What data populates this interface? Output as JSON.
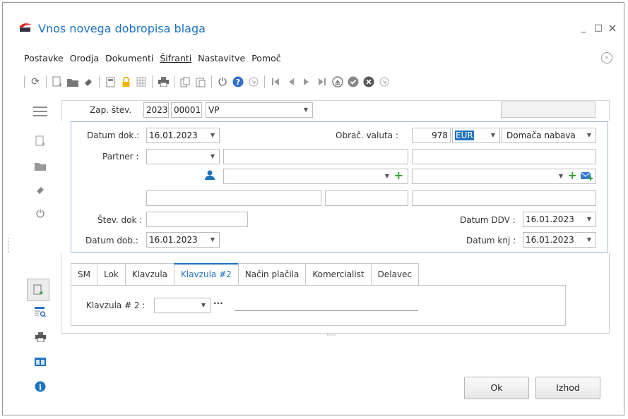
{
  "window": {
    "title": "Vnos novega dobropisa blaga",
    "minimize": "_",
    "maximize": "□",
    "close": "×"
  },
  "menu": [
    "Postavke",
    "Orodja",
    "Dokumenti",
    "Šifranti",
    "Nastavitve",
    "Pomoč"
  ],
  "header": {
    "zap_label": "Zap. štev.",
    "year": "2023",
    "number": "00001",
    "type": "VP"
  },
  "form": {
    "datum_dok_label": "Datum dok.:",
    "datum_dok": "16.01.2023",
    "obrac_valuta_label": "Obrač. valuta :",
    "valuta_code": "978",
    "valuta": "EUR",
    "nabava": "Domača nabava",
    "partner_label": "Partner :",
    "partner": "",
    "stev_dok_label": "Štev. dok :",
    "stev_dok": "",
    "datum_ddv_label": "Datum DDV :",
    "datum_ddv": "16.01.2023",
    "datum_dob_label": "Datum dob.:",
    "datum_dob": "16.01.2023",
    "datum_knj_label": "Datum knj :",
    "datum_knj": "16.01.2023"
  },
  "tabs": [
    "SM",
    "Lok",
    "Klavzula",
    "Klavzula #2",
    "Način plačila",
    "Komercialist",
    "Delavec"
  ],
  "active_tab": "Klavzula #2",
  "klavzula2": {
    "label": "Klavzula # 2 :",
    "value": "",
    "ellipsis": "···"
  },
  "splitter": "·······",
  "buttons": {
    "ok": "Ok",
    "izhod": "Izhod"
  },
  "colors": {
    "accent": "#1e73be",
    "green": "#2da22d",
    "selection": "#1e73be"
  }
}
